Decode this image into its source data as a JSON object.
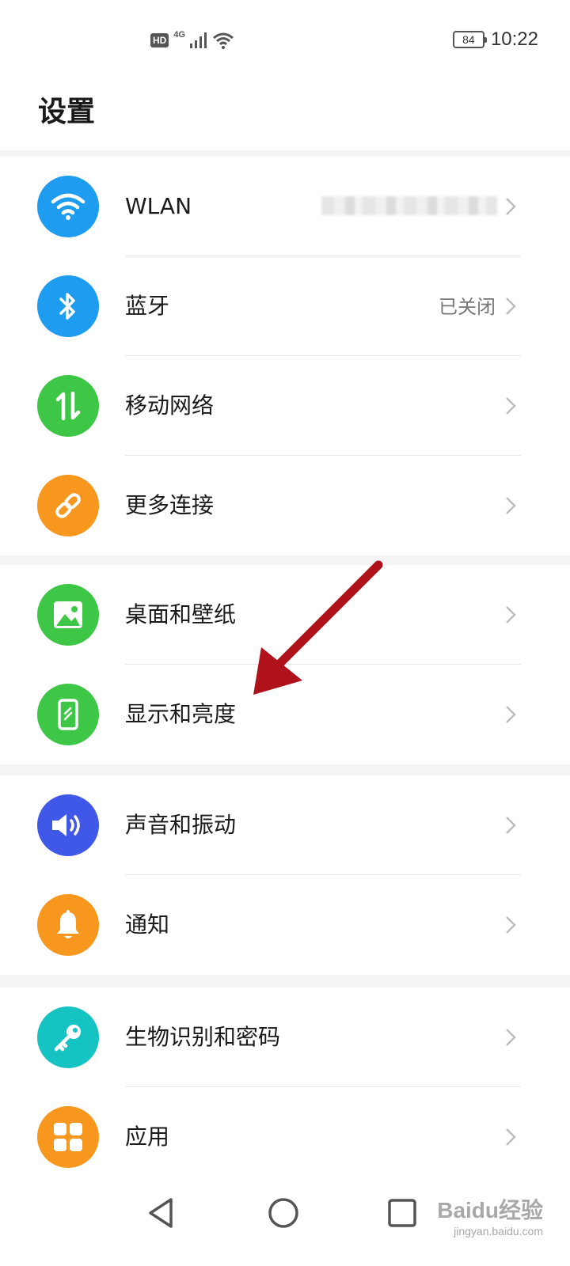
{
  "status_bar": {
    "hd": "HD",
    "network": "4G",
    "battery": "84",
    "time": "10:22"
  },
  "header": {
    "title": "设置"
  },
  "groups": [
    {
      "items": [
        {
          "label": "WLAN",
          "value": "",
          "icon": "wifi-icon",
          "color": "#1e9cf0"
        },
        {
          "label": "蓝牙",
          "value": "已关闭",
          "icon": "bluetooth-icon",
          "color": "#1e9cf0"
        },
        {
          "label": "移动网络",
          "value": "",
          "icon": "mobile-data-icon",
          "color": "#3ec747"
        },
        {
          "label": "更多连接",
          "value": "",
          "icon": "link-icon",
          "color": "#f7971d"
        }
      ]
    },
    {
      "items": [
        {
          "label": "桌面和壁纸",
          "value": "",
          "icon": "image-icon",
          "color": "#3ec747"
        },
        {
          "label": "显示和亮度",
          "value": "",
          "icon": "phone-display-icon",
          "color": "#3ec747"
        }
      ]
    },
    {
      "items": [
        {
          "label": "声音和振动",
          "value": "",
          "icon": "speaker-icon",
          "color": "#4058e8"
        },
        {
          "label": "通知",
          "value": "",
          "icon": "bell-icon",
          "color": "#f7971d"
        }
      ]
    },
    {
      "items": [
        {
          "label": "生物识别和密码",
          "value": "",
          "icon": "key-icon",
          "color": "#15c3c3"
        },
        {
          "label": "应用",
          "value": "",
          "icon": "apps-grid-icon",
          "color": "#f7971d"
        }
      ]
    }
  ],
  "watermark": {
    "logo": "Baidu经验",
    "url": "jingyan.baidu.com"
  },
  "colors": {
    "annotation_arrow": "#b0121b"
  }
}
